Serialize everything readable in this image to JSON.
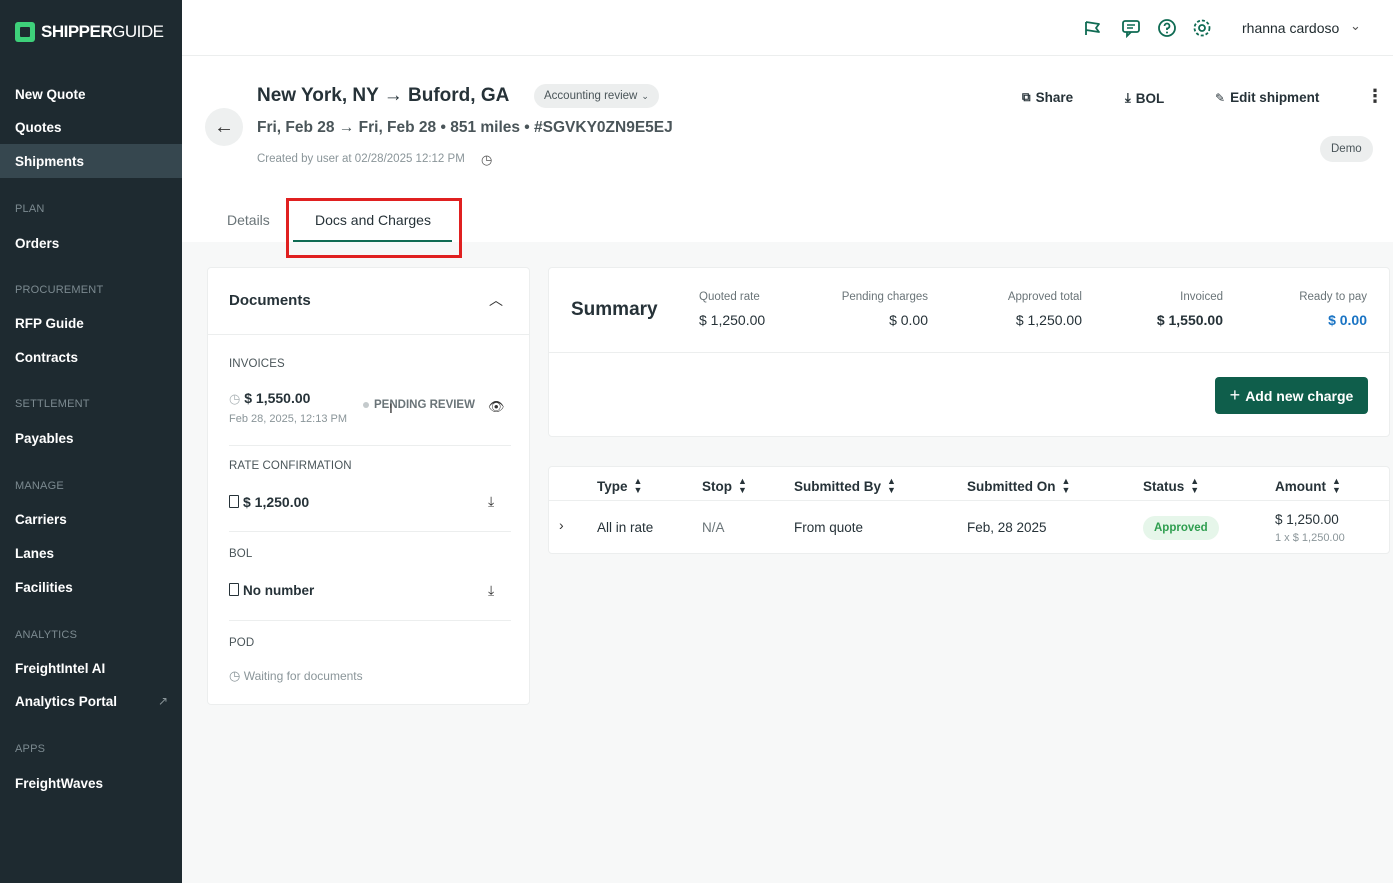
{
  "brand": {
    "name_bold": "SHIPPER",
    "name_light": "GUIDE"
  },
  "sidebar": {
    "items": [
      {
        "label": "New Quote"
      },
      {
        "label": "Quotes"
      },
      {
        "label": "Shipments"
      },
      {
        "label": "Orders"
      },
      {
        "label": "RFP Guide"
      },
      {
        "label": "Contracts"
      },
      {
        "label": "Payables"
      },
      {
        "label": "Carriers"
      },
      {
        "label": "Lanes"
      },
      {
        "label": "Facilities"
      },
      {
        "label": "FreightIntel AI"
      },
      {
        "label": "Analytics Portal"
      },
      {
        "label": "FreightWaves"
      }
    ],
    "sections": [
      "PLAN",
      "PROCUREMENT",
      "SETTLEMENT",
      "MANAGE",
      "ANALYTICS",
      "APPS"
    ]
  },
  "topbar": {
    "user": "rhanna cardoso"
  },
  "shipment": {
    "route": "New York, NY → Buford, GA",
    "status": "Accounting review",
    "subline": "Fri, Feb 28 → Fri, Feb 28 • 851 miles • #SGVKY0ZN9E5EJ",
    "created": "Created by user at 02/28/2025 12:12 PM",
    "actions": {
      "share": "Share",
      "bol": "BOL",
      "edit": "Edit shipment"
    },
    "demo": "Demo"
  },
  "tabs": {
    "details": "Details",
    "docs": "Docs and Charges"
  },
  "documents": {
    "title": "Documents",
    "invoices_label": "INVOICES",
    "invoice_amount": "$ 1,550.00",
    "invoice_date": "Feb 28, 2025, 12:13 PM",
    "invoice_status": "PENDING REVIEW",
    "rate_label": "RATE CONFIRMATION",
    "rate_amount": "$ 1,250.00",
    "bol_label": "BOL",
    "bol_value": "No number",
    "pod_label": "POD",
    "pod_value": "Waiting for documents"
  },
  "summary": {
    "title": "Summary",
    "metrics": [
      {
        "label": "Quoted rate",
        "value": "$ 1,250.00"
      },
      {
        "label": "Pending charges",
        "value": "$ 0.00"
      },
      {
        "label": "Approved total",
        "value": "$ 1,250.00"
      },
      {
        "label": "Invoiced",
        "value": "$ 1,550.00"
      },
      {
        "label": "Ready to pay",
        "value": "$ 0.00"
      }
    ],
    "add_button": "Add new charge"
  },
  "charges_table": {
    "headers": [
      "Type",
      "Stop",
      "Submitted By",
      "Submitted On",
      "Status",
      "Amount"
    ],
    "rows": [
      {
        "type": "All in rate",
        "stop": "N/A",
        "submitted_by": "From quote",
        "submitted_on": "Feb, 28 2025",
        "status": "Approved",
        "amount": "$ 1,250.00",
        "amount_detail": "1 x $ 1,250.00"
      }
    ]
  }
}
